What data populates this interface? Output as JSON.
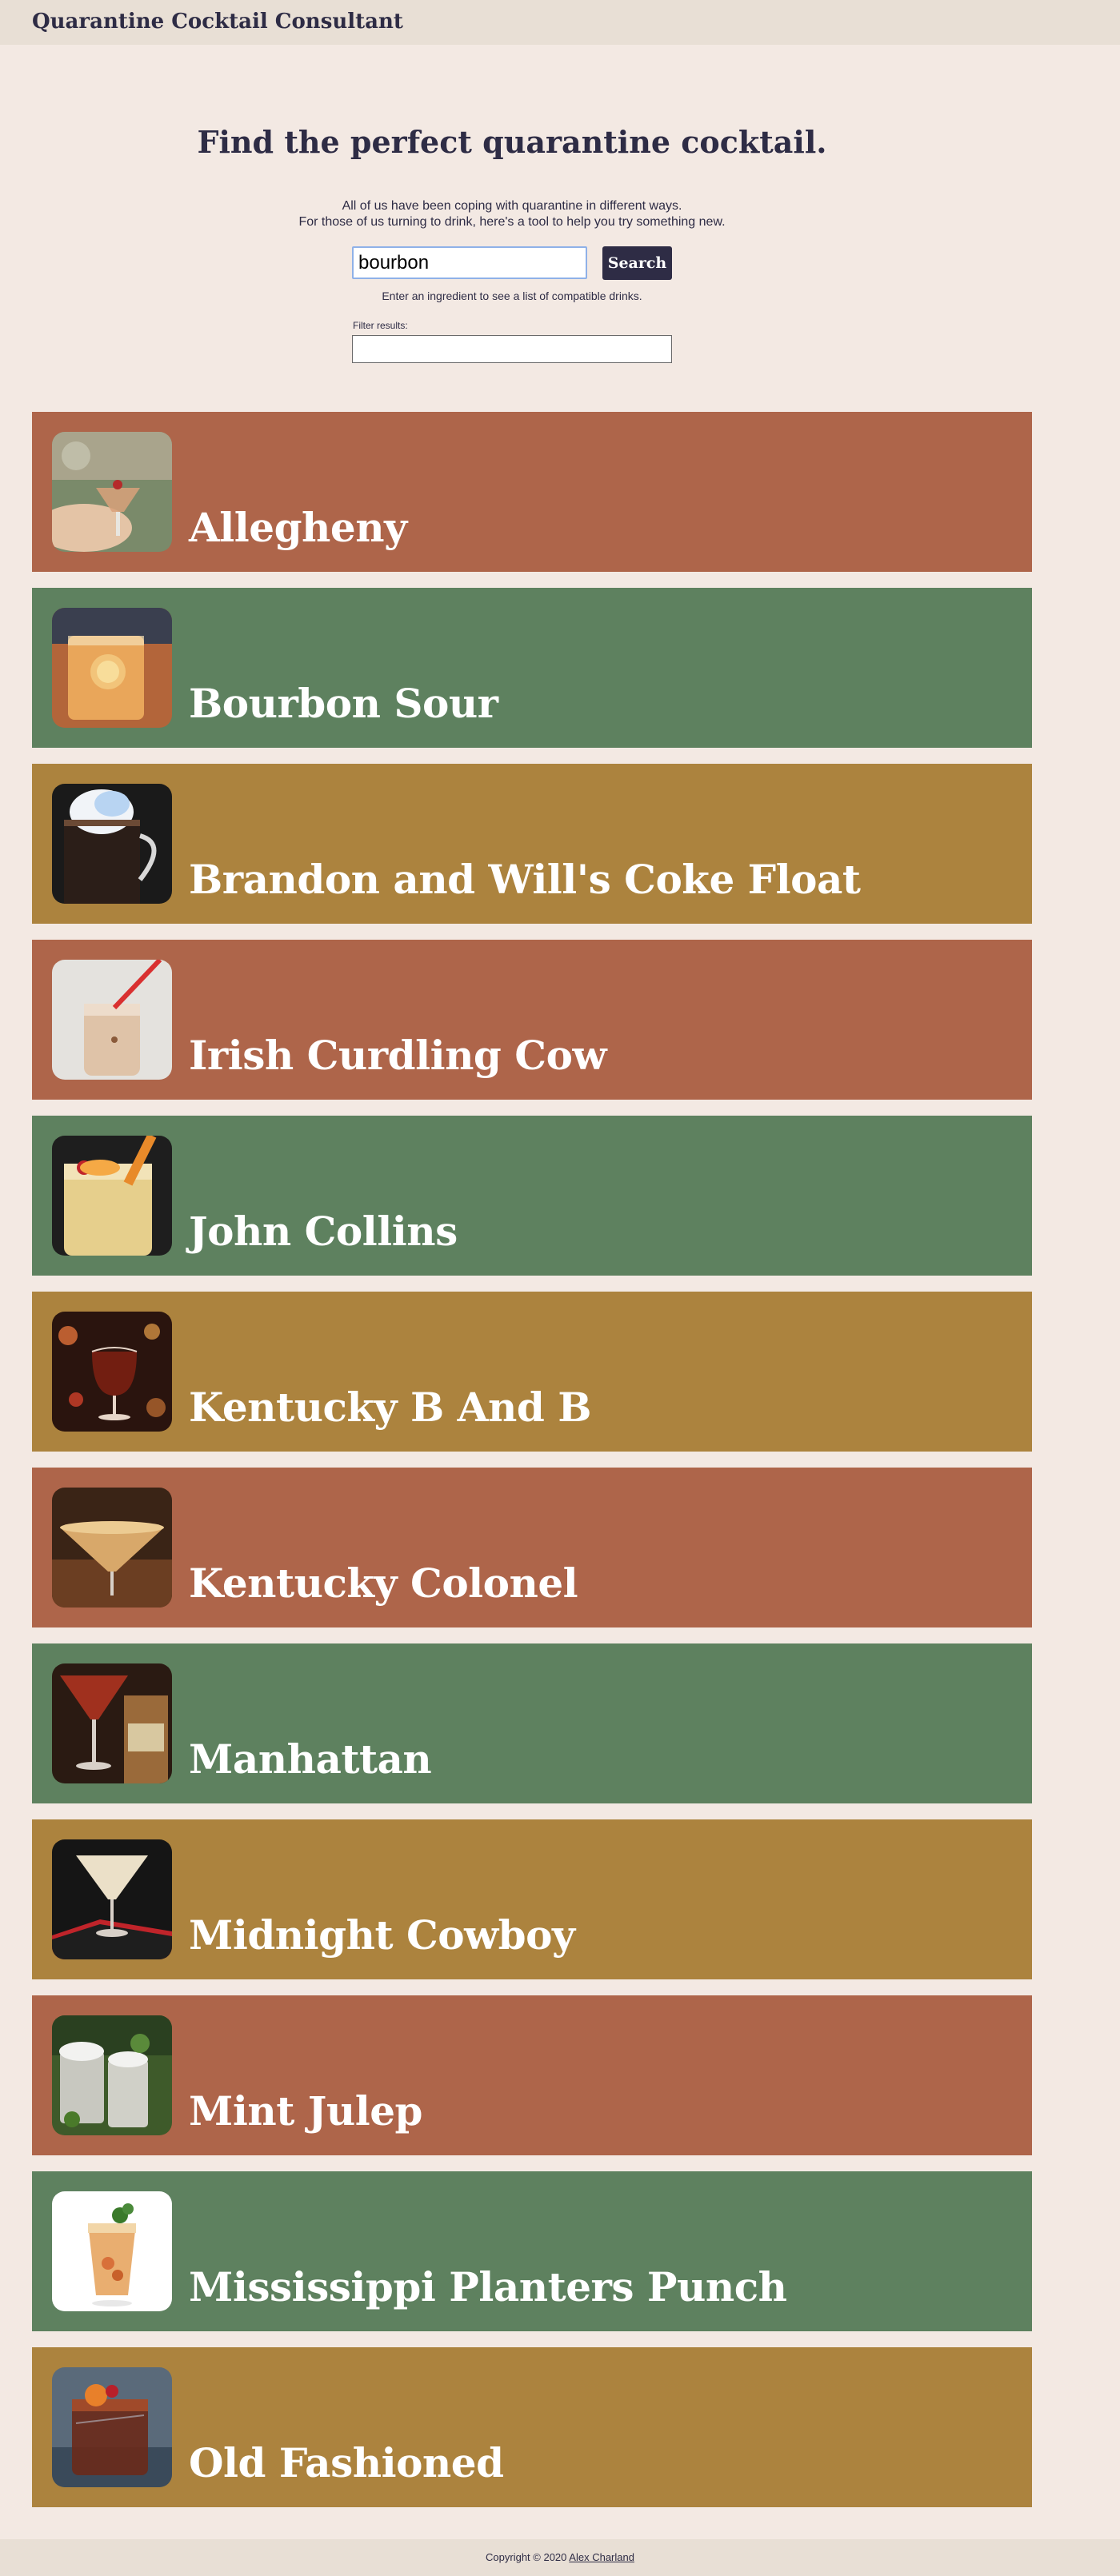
{
  "header": {
    "brand": "Quarantine Cocktail Consultant"
  },
  "hero": {
    "title": "Find the perfect quarantine cocktail.",
    "intro_line1": "All of us have been coping with quarantine in different ways.",
    "intro_line2": "For those of us turning to drink, here's a tool to help you try something new."
  },
  "search": {
    "value": "bourbon",
    "button_label": "Search",
    "hint": "Enter an ingredient to see a list of compatible drinks."
  },
  "filter": {
    "label": "Filter results:",
    "value": ""
  },
  "colors": {
    "rust": "#ae654a",
    "green": "#5e815f",
    "gold": "#ac833e",
    "navy": "#2e2c45",
    "background": "#f3e9e3"
  },
  "drinks": [
    {
      "name": "Allegheny",
      "color": "#ae654a",
      "image": "allegheny-photo"
    },
    {
      "name": "Bourbon Sour",
      "color": "#5e815f",
      "image": "bourbon-sour-photo"
    },
    {
      "name": "Brandon and Will's Coke Float",
      "color": "#ac833e",
      "image": "coke-float-photo"
    },
    {
      "name": "Irish Curdling Cow",
      "color": "#ae654a",
      "image": "irish-curdling-cow-photo"
    },
    {
      "name": "John Collins",
      "color": "#5e815f",
      "image": "john-collins-photo"
    },
    {
      "name": "Kentucky B And B",
      "color": "#ac833e",
      "image": "kentucky-b-and-b-photo"
    },
    {
      "name": "Kentucky Colonel",
      "color": "#ae654a",
      "image": "kentucky-colonel-photo"
    },
    {
      "name": "Manhattan",
      "color": "#5e815f",
      "image": "manhattan-photo"
    },
    {
      "name": "Midnight Cowboy",
      "color": "#ac833e",
      "image": "midnight-cowboy-photo"
    },
    {
      "name": "Mint Julep",
      "color": "#ae654a",
      "image": "mint-julep-photo"
    },
    {
      "name": "Mississippi Planters Punch",
      "color": "#5e815f",
      "image": "mississippi-planters-punch-photo"
    },
    {
      "name": "Old Fashioned",
      "color": "#ac833e",
      "image": "old-fashioned-photo"
    }
  ],
  "footer": {
    "copyright": "Copyright © 2020",
    "author": "Alex Charland"
  }
}
